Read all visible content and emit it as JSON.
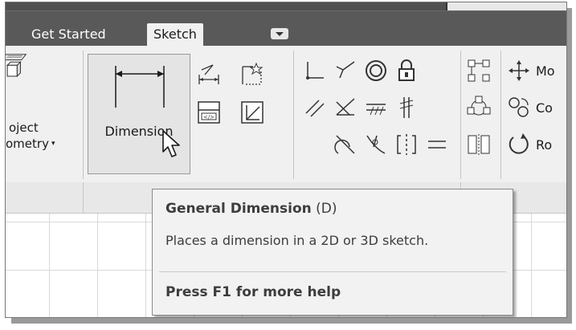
{
  "tabs": [
    {
      "label": "Get Started",
      "active": false
    },
    {
      "label": "Sketch",
      "active": true
    }
  ],
  "tab_dropdown_icon": "chevron-down-icon",
  "ribbon": {
    "project_geometry": {
      "line1": "oject",
      "line2": "ometry"
    },
    "dimension_button": {
      "label": "Dimension",
      "icon": "general-dimension-icon"
    },
    "right_labels": [
      "Mo",
      "Co",
      "Ro"
    ]
  },
  "tooltip": {
    "title": "General Dimension",
    "shortcut": "(D)",
    "description": "Places a dimension in a 2D or 3D sketch.",
    "help": "Press F1 for more help"
  },
  "colors": {
    "tab_bar": "#595959",
    "ribbon": "#f0f0f0",
    "tooltip_bg": "#f2f2f2"
  }
}
